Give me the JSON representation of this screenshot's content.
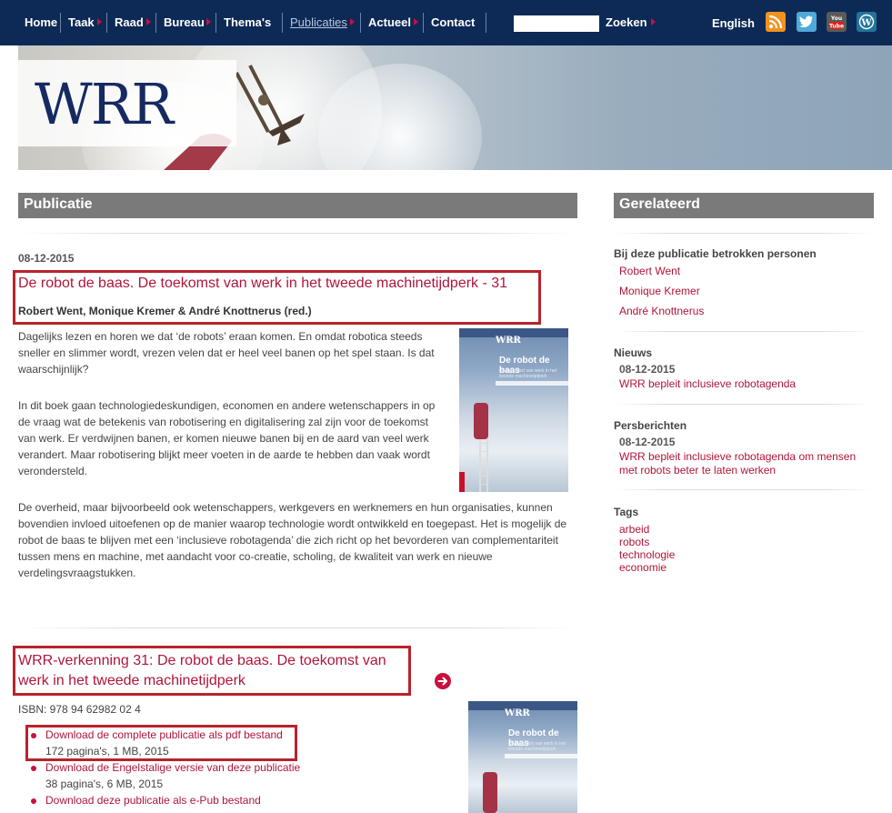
{
  "nav": {
    "items": [
      {
        "label": "Home"
      },
      {
        "label": "Taak"
      },
      {
        "label": "Raad"
      },
      {
        "label": "Bureau"
      },
      {
        "label": "Thema's"
      },
      {
        "label": "Publicaties"
      },
      {
        "label": "Actueel"
      },
      {
        "label": "Contact"
      }
    ],
    "search_placeholder": "",
    "search_label": "Zoeken",
    "language": "English",
    "social_icons": [
      "rss-icon",
      "twitter-icon",
      "youtube-icon",
      "wordpress-icon"
    ]
  },
  "banner": {
    "logo": "WRR"
  },
  "main": {
    "header": "Publicatie",
    "date": "08-12-2015",
    "title": "De robot de baas. De toekomst van werk in het tweede machinetijdperk - 31",
    "authors": "Robert Went, Monique Kremer & André Knottnerus (red.)",
    "paragraphs": [
      "Dagelijks lezen en horen we dat ‘de robots’ eraan komen. En omdat robotica steeds sneller en slimmer wordt, vrezen velen dat er heel veel banen op het spel staan. Is dat waarschijnlijk?",
      "In dit boek gaan technologiedeskundigen, economen en andere wetenschappers in op de vraag wat de betekenis van robotisering en digitalisering zal zijn voor de toekomst van werk. Er verdwijnen banen, er komen nieuwe banen bij en de aard van veel werk verandert. Maar robotisering blijkt meer voeten in de aarde te hebben dan vaak wordt verondersteld.",
      "De overheid, maar bijvoorbeeld ook wetenschappers, werkgevers en werknemers en hun organisaties, kunnen bovendien invloed uitoefenen op de manier waarop technologie wordt ontwikkeld en toegepast. Het is mogelijk de robot de baas te blijven met een ‘inclusieve robotagenda’ die zich richt op het bevorderen van complementariteit tussen mens en machine, met aandacht voor co-creatie, scholing, de kwaliteit van werk en nieuwe verdelingsvraagstukken."
    ],
    "cover": {
      "brand": "WRR",
      "title": "De robot de baas",
      "subtitle": "De toekomst van werk in het tweede machinetijdperk"
    },
    "verkenning": {
      "title": "WRR-verkenning 31: De robot de baas. De toekomst van werk in het tweede machinetijdperk",
      "isbn": "ISBN: 978 94 62982 02 4",
      "downloads": [
        {
          "label": "Download de complete publicatie als pdf bestand",
          "meta": "172 pagina's, 1 MB, 2015"
        },
        {
          "label": "Download de Engelstalige versie van deze publicatie",
          "meta": "38 pagina's, 6 MB, 2015"
        },
        {
          "label": "Download deze publicatie als e-Pub bestand",
          "meta": ""
        }
      ]
    }
  },
  "sidebar": {
    "header": "Gerelateerd",
    "persons_heading": "Bij deze publicatie betrokken personen",
    "persons": [
      "Robert Went",
      "Monique Kremer",
      "André Knottnerus"
    ],
    "news_heading": "Nieuws",
    "news_date": "08-12-2015",
    "news_link": "WRR bepleit inclusieve robotagenda",
    "press_heading": "Persberichten",
    "press_date": "08-12-2015",
    "press_link": "WRR bepleit inclusieve robotagenda om mensen met robots beter te laten werken",
    "tags_heading": "Tags",
    "tags": [
      "arbeid",
      "robots",
      "technologie",
      "economie"
    ]
  },
  "colors": {
    "nav_bg": "#0c2a55",
    "accent": "#b0153a",
    "header_bg": "#7a7a7a",
    "highlight": "#b8232b"
  }
}
